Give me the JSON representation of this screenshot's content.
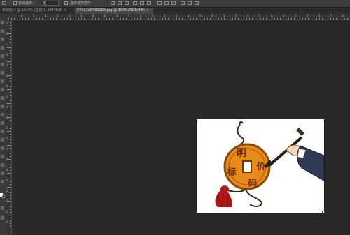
{
  "options_bar": {
    "auto_select_label": "自动选择：",
    "auto_select_value": "组",
    "show_transform_label": "显示变换控件"
  },
  "tabs": [
    {
      "label": "未标题-1 @ 14.2% (图层 1, CMYK/8)",
      "close": "×",
      "active": false
    },
    {
      "label": "57d12e8703205.jpg @ 100%(RGB/8#)",
      "close": "×",
      "active": true
    }
  ],
  "ruler": {
    "top_labels": [
      "0",
      "5",
      "1",
      "0",
      "1",
      "5",
      "2",
      "0",
      "2",
      "5",
      "3",
      "0",
      "3",
      "5",
      "4",
      "0",
      "4",
      "5",
      "5",
      "0",
      "5",
      "5",
      "6",
      "0",
      "6",
      "5",
      "7",
      "0"
    ],
    "left_labels": [
      "0",
      "5",
      "1",
      "0",
      "1",
      "5",
      "2",
      "0",
      "2",
      "5",
      "3",
      "0",
      "3",
      "5",
      "4",
      "0",
      "4",
      "5",
      "5",
      "0"
    ]
  },
  "document": {
    "image_name": "57d12e8703205.jpg",
    "coin_text": [
      "明",
      "价",
      "标",
      "码"
    ]
  },
  "colors": {
    "workspace": "#282828",
    "panel": "#3c3c3c",
    "coin": "#e88a1a",
    "tassel": "#b01818"
  }
}
